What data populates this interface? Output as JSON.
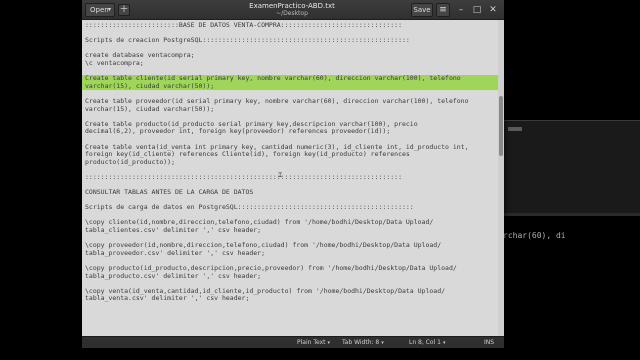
{
  "window": {
    "title": "ExamenPractico-ABD.txt",
    "subtitle": "~/Desktop",
    "open_label": "Open",
    "save_label": "Save"
  },
  "editor": {
    "highlight_color": "#9fd65a",
    "lines": [
      {
        "text": "::::::::::::::::::::::::BASE DE DATOS VENTA-COMPRA:::::::::::::::::::::::::::::::",
        "hl": false
      },
      {
        "text": "",
        "hl": false
      },
      {
        "text": "Scripts de creacion PostgreSQL:::::::::::::::::::::::::::::::::::::::::::::::::::::",
        "hl": false
      },
      {
        "text": "",
        "hl": false
      },
      {
        "text": "create database ventacompra;",
        "hl": false
      },
      {
        "text": "\\c ventacompra;",
        "hl": false
      },
      {
        "text": "",
        "hl": false
      },
      {
        "text": "Create table cliente(id serial primary key, nombre varchar(60), direccion varchar(100), telefono",
        "hl": true
      },
      {
        "text": "varchar(15), ciudad varchar(50));",
        "hl": true
      },
      {
        "text": "",
        "hl": false
      },
      {
        "text": "Create table proveedor(id serial primary key, nombre varchar(60), direccion varchar(100), telefono",
        "hl": false
      },
      {
        "text": "varchar(15), ciudad varchar(50));",
        "hl": false
      },
      {
        "text": "",
        "hl": false
      },
      {
        "text": "Create table producto(id_producto serial primary key,descripcion varchar(100), precio",
        "hl": false
      },
      {
        "text": "decimal(6,2), proveedor int, foreign key(proveedor) references proveedor(id));",
        "hl": false
      },
      {
        "text": "",
        "hl": false
      },
      {
        "text": "Create table venta(id_venta int primary key, cantidad numeric(3), id_cliente int, id_producto int,",
        "hl": false
      },
      {
        "text": "foreign key(id_cliente) references Cliente(id), foreign key(id_producto) references",
        "hl": false
      },
      {
        "text": "producto(id_producto));",
        "hl": false
      },
      {
        "text": "",
        "hl": false
      },
      {
        "text": ":::::::::::::::::::::::::::::::::::::::::::::::::::::::::::::::::::::::::::::::::",
        "hl": false
      },
      {
        "text": "",
        "hl": false
      },
      {
        "text": "CONSULTAR TABLAS ANTES DE LA CARGA DE DATOS",
        "hl": false
      },
      {
        "text": "",
        "hl": false
      },
      {
        "text": "Scripts de carga de datos en PostgreSQL:::::::::::::::::::::::::::::::::::::::::::::",
        "hl": false
      },
      {
        "text": "",
        "hl": false
      },
      {
        "text": "\\copy cliente(id,nombre,direccion,telefono,ciudad) from '/home/bodhi/Desktop/Data Upload/",
        "hl": false
      },
      {
        "text": "tabla_clientes.csv' delimiter ',' csv header;",
        "hl": false
      },
      {
        "text": "",
        "hl": false
      },
      {
        "text": "\\copy proveedor(id,nombre,direccion,telefono,ciudad) from '/home/bodhi/Desktop/Data Upload/",
        "hl": false
      },
      {
        "text": "tabla_proveedor.csv' delimiter ',' csv header;",
        "hl": false
      },
      {
        "text": "",
        "hl": false
      },
      {
        "text": "\\copy producto(id_producto,descripcion,precio,proveedor) from '/home/bodhi/Desktop/Data Upload/",
        "hl": false
      },
      {
        "text": "tabla_producto.csv' delimiter ',' csv header;",
        "hl": false
      },
      {
        "text": "",
        "hl": false
      },
      {
        "text": "\\copy venta(id_venta,cantidad,id_cliente,id_producto) from '/home/bodhi/Desktop/Data Upload/",
        "hl": false
      },
      {
        "text": "tabla_venta.csv' delimiter ',' csv header;",
        "hl": false
      },
      {
        "text": "",
        "hl": false
      },
      {
        "text": "",
        "hl": false
      },
      {
        "text": "",
        "hl": false
      },
      {
        "text": "",
        "hl": false
      }
    ]
  },
  "statusbar": {
    "syntax": "Plain Text",
    "tab_width": "Tab Width: 8",
    "position": "Ln 8, Col 1",
    "mode": "INS"
  },
  "background_terminal": {
    "text": "rchar(60), di"
  }
}
